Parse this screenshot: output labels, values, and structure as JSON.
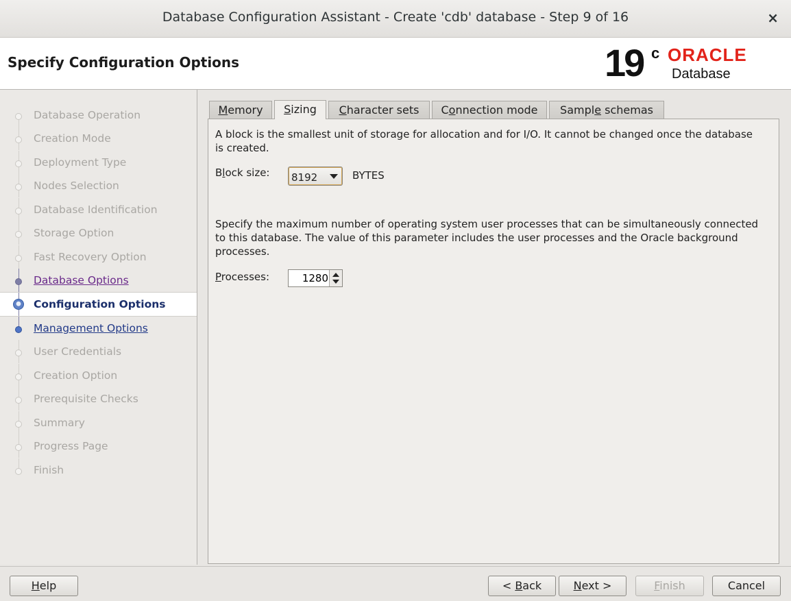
{
  "window": {
    "title": "Database Configuration Assistant - Create 'cdb' database - Step 9 of 16",
    "close_glyph": "×"
  },
  "header": {
    "title": "Specify Configuration Options",
    "logo": {
      "version": "19",
      "superscript": "c",
      "brand": "ORACLE",
      "product": "Database"
    }
  },
  "steps": [
    {
      "label": "Database Operation",
      "state": "done"
    },
    {
      "label": "Creation Mode",
      "state": "done"
    },
    {
      "label": "Deployment Type",
      "state": "done"
    },
    {
      "label": "Nodes Selection",
      "state": "done"
    },
    {
      "label": "Database Identification",
      "state": "done"
    },
    {
      "label": "Storage Option",
      "state": "done"
    },
    {
      "label": "Fast Recovery Option",
      "state": "done"
    },
    {
      "label": "Database Options",
      "state": "visited"
    },
    {
      "label": "Configuration Options",
      "state": "current"
    },
    {
      "label": "Management Options",
      "state": "link"
    },
    {
      "label": "User Credentials",
      "state": "pending"
    },
    {
      "label": "Creation Option",
      "state": "pending"
    },
    {
      "label": "Prerequisite Checks",
      "state": "pending"
    },
    {
      "label": "Summary",
      "state": "pending"
    },
    {
      "label": "Progress Page",
      "state": "pending"
    },
    {
      "label": "Finish",
      "state": "pending"
    }
  ],
  "tabs": {
    "memory": {
      "pre": "",
      "u": "M",
      "post": "emory"
    },
    "sizing": {
      "pre": "",
      "u": "S",
      "post": "izing"
    },
    "charsets": {
      "pre": "",
      "u": "C",
      "post": "haracter sets"
    },
    "connection": {
      "pre": "C",
      "u": "o",
      "post": "nnection mode"
    },
    "sample": {
      "pre": "Sampl",
      "u": "e",
      "post": " schemas"
    },
    "active": "sizing"
  },
  "sizing": {
    "block_description": "A block is the smallest unit of storage for allocation and for I/O. It cannot be changed once the database is created.",
    "block_label_pre": "B",
    "block_label_u": "l",
    "block_label_post": "ock size:",
    "block_size_value": "8192",
    "block_unit": "BYTES",
    "processes_description": "Specify the maximum number of operating system user processes that can be simultaneously connected to this database. The value of this parameter includes the user processes and the Oracle background processes.",
    "processes_label_u": "P",
    "processes_label_post": "rocesses:",
    "processes_value": "1280"
  },
  "footer": {
    "help": {
      "u": "H",
      "post": "elp"
    },
    "back": {
      "pre": "< ",
      "u": "B",
      "post": "ack"
    },
    "next": {
      "u": "N",
      "post": "ext >"
    },
    "finish": {
      "u": "F",
      "post": "inish"
    },
    "cancel": "Cancel"
  }
}
